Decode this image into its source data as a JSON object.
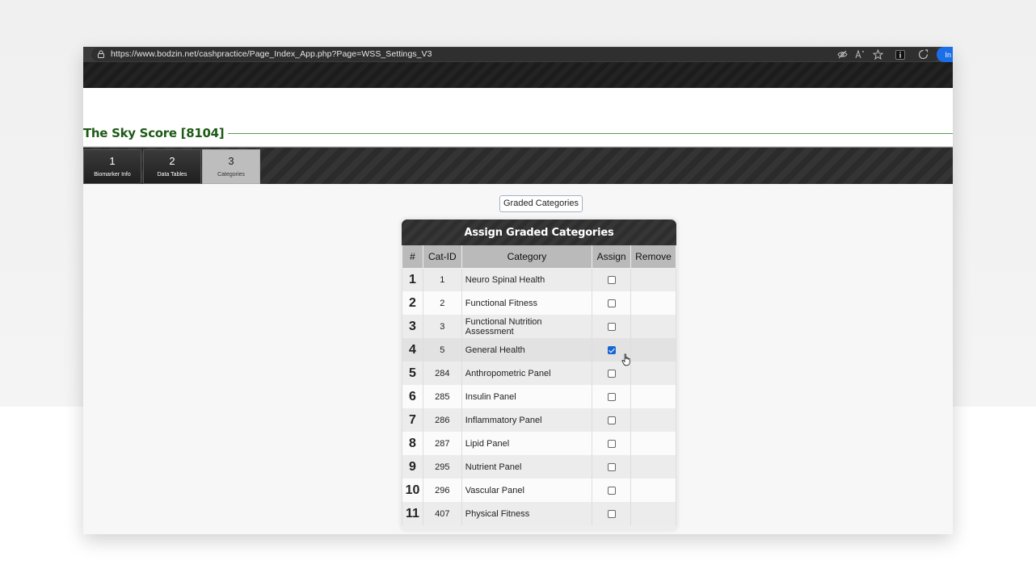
{
  "browser": {
    "url": "https://www.bodzin.net/cashpractice/Page_Index_App.php?Page=WSS_Settings_V3",
    "icons": [
      "lock-icon",
      "eye-off-icon",
      "read-aloud-icon",
      "favorite-star-icon",
      "info-icon",
      "extensions-icon"
    ],
    "profile_label": "In"
  },
  "page": {
    "title": "The Sky Score [8104]"
  },
  "tabs": [
    {
      "num": "1",
      "label": "Biomarker Info",
      "active": false
    },
    {
      "num": "2",
      "label": "Data Tables",
      "active": false
    },
    {
      "num": "3",
      "label": "Categories",
      "active": true
    }
  ],
  "graded_button": "Graded Categories",
  "table": {
    "title": "Assign Graded Categories",
    "headers": [
      "#",
      "Cat-ID",
      "Category",
      "Assign",
      "Remove"
    ],
    "rows": [
      {
        "n": "1",
        "id": "1",
        "cat": "Neuro Spinal Health",
        "assigned": false
      },
      {
        "n": "2",
        "id": "2",
        "cat": "Functional Fitness",
        "assigned": false
      },
      {
        "n": "3",
        "id": "3",
        "cat": "Functional Nutrition Assessment",
        "assigned": false
      },
      {
        "n": "4",
        "id": "5",
        "cat": "General Health",
        "assigned": true
      },
      {
        "n": "5",
        "id": "284",
        "cat": "Anthropometric Panel",
        "assigned": false
      },
      {
        "n": "6",
        "id": "285",
        "cat": "Insulin Panel",
        "assigned": false
      },
      {
        "n": "7",
        "id": "286",
        "cat": "Inflammatory Panel",
        "assigned": false
      },
      {
        "n": "8",
        "id": "287",
        "cat": "Lipid Panel",
        "assigned": false
      },
      {
        "n": "9",
        "id": "295",
        "cat": "Nutrient Panel",
        "assigned": false
      },
      {
        "n": "10",
        "id": "296",
        "cat": "Vascular Panel",
        "assigned": false
      },
      {
        "n": "11",
        "id": "407",
        "cat": "Physical Fitness",
        "assigned": false
      }
    ]
  },
  "colors": {
    "title_green": "#1d5a16",
    "checkbox_blue": "#1a66d1",
    "profile_blue": "#1a6fe8"
  }
}
